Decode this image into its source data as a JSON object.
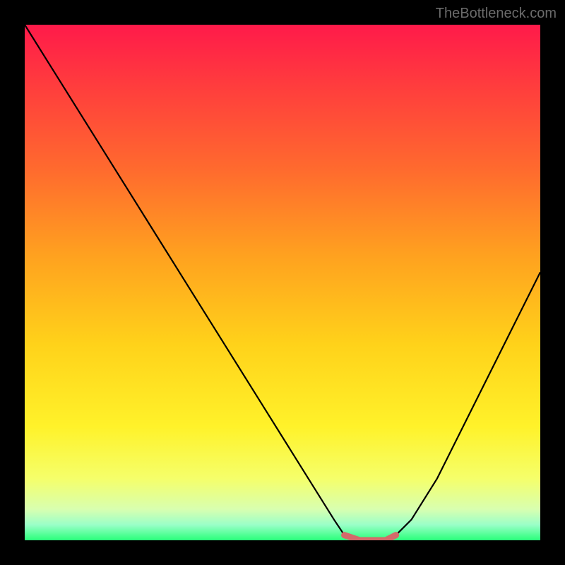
{
  "watermark": "TheBottleneck.com",
  "chart_data": {
    "type": "line",
    "title": "",
    "xlabel": "",
    "ylabel": "",
    "xlim": [
      0,
      100
    ],
    "ylim": [
      0,
      100
    ],
    "x": [
      0,
      5,
      10,
      15,
      20,
      25,
      30,
      35,
      40,
      45,
      50,
      55,
      60,
      62,
      65,
      68,
      70,
      72,
      75,
      80,
      85,
      90,
      95,
      100
    ],
    "values": [
      100,
      92,
      84,
      76,
      68,
      60,
      52,
      44,
      36,
      28,
      20,
      12,
      4,
      1,
      0,
      0,
      0,
      1,
      4,
      12,
      22,
      32,
      42,
      52
    ],
    "gradient_stops": [
      {
        "offset": 0,
        "color": "#ff1a4a"
      },
      {
        "offset": 0.12,
        "color": "#ff3d3d"
      },
      {
        "offset": 0.28,
        "color": "#ff6a2e"
      },
      {
        "offset": 0.45,
        "color": "#ffa21f"
      },
      {
        "offset": 0.62,
        "color": "#ffd21a"
      },
      {
        "offset": 0.78,
        "color": "#fff22a"
      },
      {
        "offset": 0.88,
        "color": "#f5ff6a"
      },
      {
        "offset": 0.94,
        "color": "#d8ffb0"
      },
      {
        "offset": 0.97,
        "color": "#9affc8"
      },
      {
        "offset": 1.0,
        "color": "#2aff7a"
      }
    ],
    "highlight": {
      "x_start": 62,
      "x_end": 72,
      "color": "#d46a6a"
    }
  }
}
